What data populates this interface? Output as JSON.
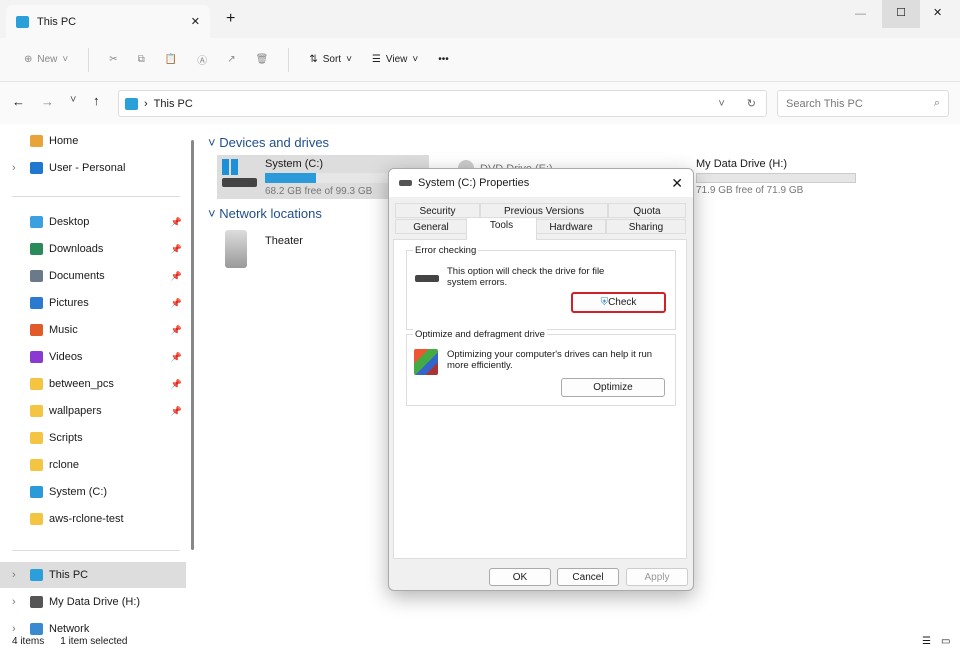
{
  "window": {
    "tab_title": "This PC",
    "new_tab": "+"
  },
  "toolbar": {
    "new": "New",
    "sort": "Sort",
    "view": "View",
    "more": "•••"
  },
  "address": {
    "location": "This PC",
    "search_placeholder": "Search This PC"
  },
  "sidebar": {
    "items": [
      {
        "label": "Home"
      },
      {
        "label": "User - Personal"
      },
      {
        "label": "Desktop",
        "pinned": true
      },
      {
        "label": "Downloads",
        "pinned": true
      },
      {
        "label": "Documents",
        "pinned": true
      },
      {
        "label": "Pictures",
        "pinned": true
      },
      {
        "label": "Music",
        "pinned": true
      },
      {
        "label": "Videos",
        "pinned": true
      },
      {
        "label": "between_pcs",
        "pinned": true
      },
      {
        "label": "wallpapers",
        "pinned": true
      },
      {
        "label": "Scripts"
      },
      {
        "label": "rclone"
      },
      {
        "label": "System (C:)"
      },
      {
        "label": "aws-rclone-test"
      },
      {
        "label": "This PC"
      },
      {
        "label": "My Data Drive (H:)"
      },
      {
        "label": "Network"
      }
    ]
  },
  "main": {
    "devices_header": "Devices and drives",
    "network_header": "Network locations",
    "drives": [
      {
        "name": "System (C:)",
        "free": "68.2 GB free of 99.3 GB",
        "used_fraction": 0.31
      },
      {
        "name": "DVD Drive (E:)"
      },
      {
        "name": "My Data Drive (H:)",
        "free": "71.9 GB free of 71.9 GB",
        "used_fraction": 0.0
      }
    ],
    "network": [
      {
        "name": "Theater"
      }
    ]
  },
  "status": {
    "items": "4 items",
    "selected": "1 item selected"
  },
  "dialog": {
    "title": "System (C:) Properties",
    "tabs_row1": [
      "Security",
      "Previous Versions",
      "Quota"
    ],
    "tabs_row2": [
      "General",
      "Tools",
      "Hardware",
      "Sharing"
    ],
    "active_tab": "Tools",
    "error_checking": {
      "label": "Error checking",
      "text": "This option will check the drive for file system errors.",
      "button": "Check"
    },
    "optimize": {
      "label": "Optimize and defragment drive",
      "text": "Optimizing your computer's drives can help it run more efficiently.",
      "button": "Optimize"
    },
    "ok": "OK",
    "cancel": "Cancel",
    "apply": "Apply",
    "highlight_color": "#d0202c"
  }
}
